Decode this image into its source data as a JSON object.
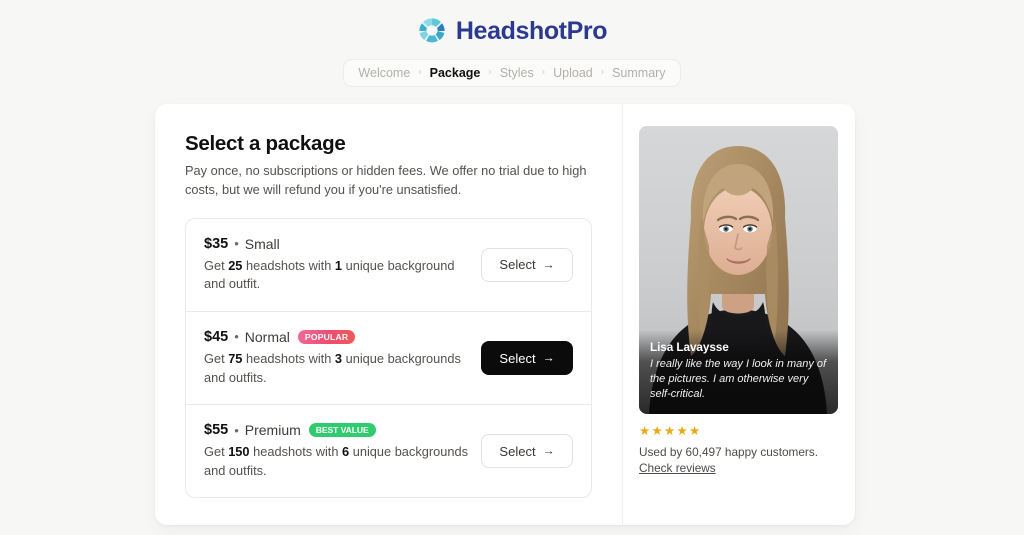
{
  "brand": {
    "name": "HeadshotPro",
    "logo_icon": "headshotpro-petal-circle-logo",
    "name_color": "#2b3a8f",
    "logo_colors": [
      "#5ec8d8",
      "#3aa8c9",
      "#2f7fc1",
      "#7fd4e0"
    ]
  },
  "breadcrumb": {
    "separator": "›",
    "steps": [
      {
        "label": "Welcome",
        "active": false
      },
      {
        "label": "Package",
        "active": true
      },
      {
        "label": "Styles",
        "active": false
      },
      {
        "label": "Upload",
        "active": false
      },
      {
        "label": "Summary",
        "active": false
      }
    ]
  },
  "main": {
    "title": "Select a package",
    "subtitle": "Pay once, no subscriptions or hidden fees. We offer no trial due to high costs, but we will refund you if you're unsatisfied.",
    "packages": [
      {
        "price": "$35",
        "separator": "•",
        "name": "Small",
        "badge": null,
        "desc_prefix": "Get ",
        "desc_count": "25",
        "desc_middle": " headshots with ",
        "desc_count2": "1",
        "desc_suffix": " unique background and outfit.",
        "button_label": "Select",
        "button_arrow": "→",
        "button_style": "light"
      },
      {
        "price": "$45",
        "separator": "•",
        "name": "Normal",
        "badge": "POPULAR",
        "badge_color": "#ee4e6f",
        "desc_prefix": "Get ",
        "desc_count": "75",
        "desc_middle": " headshots with ",
        "desc_count2": "3",
        "desc_suffix": " unique backgrounds and outfits.",
        "button_label": "Select",
        "button_arrow": "→",
        "button_style": "dark"
      },
      {
        "price": "$55",
        "separator": "•",
        "name": "Premium",
        "badge": "BEST VALUE",
        "badge_color": "#2ecc6e",
        "desc_prefix": "Get ",
        "desc_count": "150",
        "desc_middle": " headshots with ",
        "desc_count2": "6",
        "desc_suffix": " unique backgrounds and outfits.",
        "button_label": "Select",
        "button_arrow": "→",
        "button_style": "light"
      }
    ]
  },
  "sidebar": {
    "photo_alt": "portrait-of-blonde-woman-in-black-turtleneck",
    "testimonial": {
      "name": "Lisa Lavaysse",
      "quote": "I really like the way I look in many of the pictures. I am otherwise very self-critical."
    },
    "rating": {
      "stars": "★★★★★",
      "star_count": 5,
      "star_color": "#e8aa12"
    },
    "used_by": "Used by 60,497 happy customers.",
    "check_reviews_label": "Check reviews"
  }
}
